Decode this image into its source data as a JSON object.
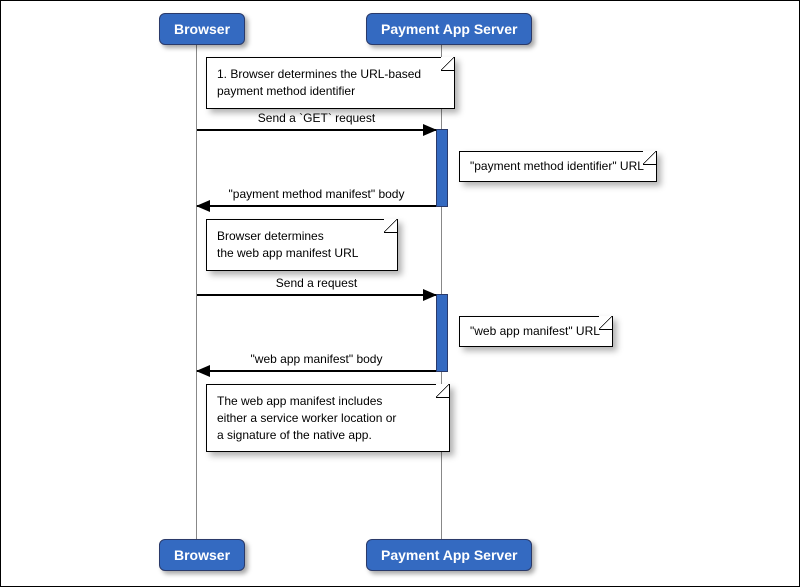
{
  "participants": {
    "browser": "Browser",
    "server": "Payment App Server"
  },
  "notes": {
    "n1_line1": "1. Browser determines the URL-based",
    "n1_line2": "payment method identifier",
    "n2_line1": "Browser determines",
    "n2_line2": "the web app manifest URL",
    "n3_line1": "The web app manifest includes",
    "n3_line2": "either a service worker location or",
    "n3_line3": "a signature of the native app.",
    "side1": "\"payment method identifier\" URL",
    "side2": "\"web app manifest\" URL"
  },
  "messages": {
    "m1": "Send a `GET` request",
    "m2": "\"payment method manifest\" body",
    "m3": "Send a request",
    "m4": "\"web app manifest\" body"
  },
  "colors": {
    "participant_bg": "#346ac1",
    "participant_fg": "#ffffff"
  }
}
